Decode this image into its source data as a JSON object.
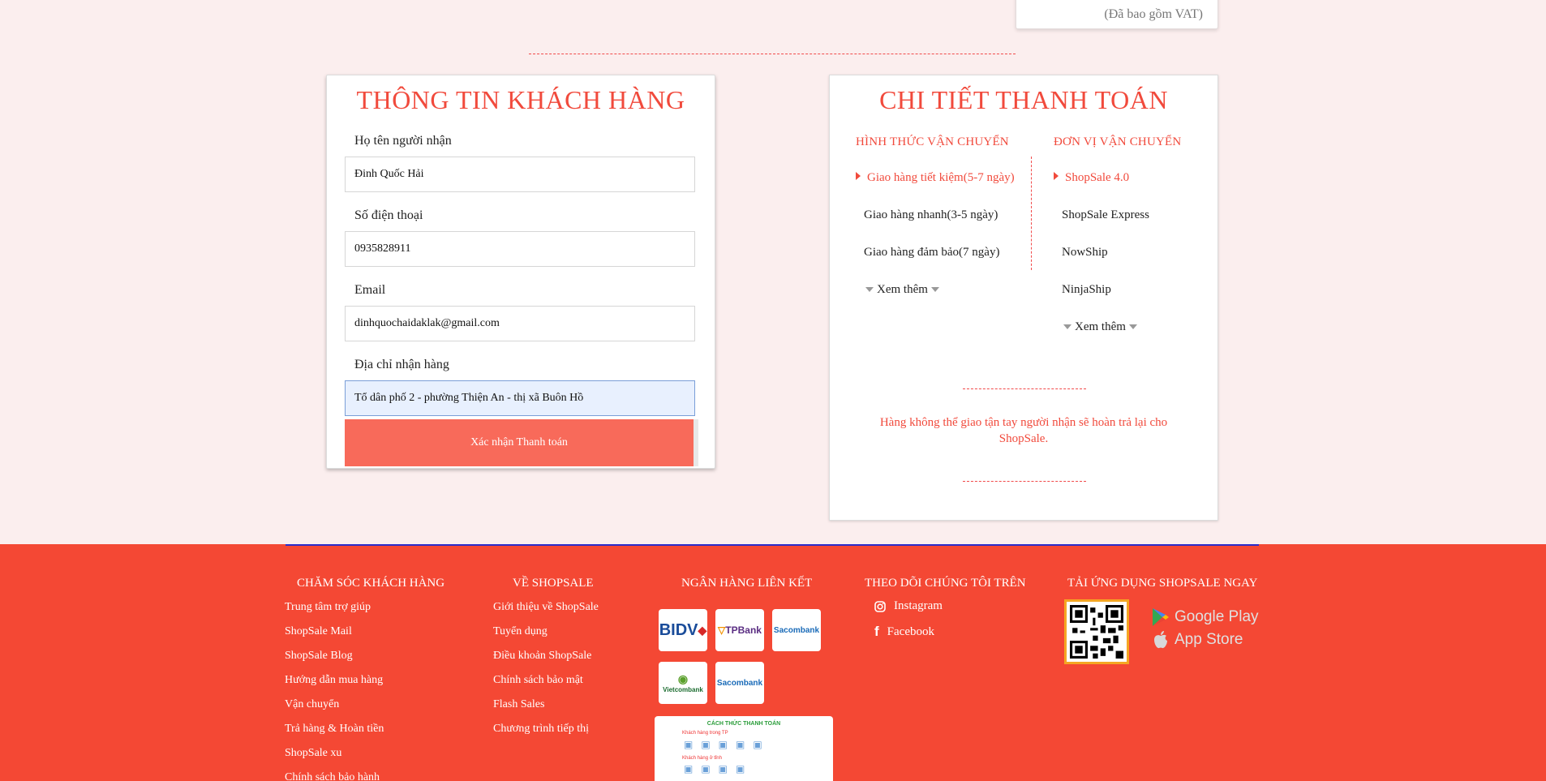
{
  "top_card": {
    "vat_text": "(Đã bao gồm VAT)"
  },
  "customer": {
    "title": "THÔNG TIN KHÁCH HÀNG",
    "fields": [
      {
        "label": "Họ tên người nhận",
        "value": "Đinh Quốc Hải"
      },
      {
        "label": "Số điện thoại",
        "value": "0935828911"
      },
      {
        "label": "Email",
        "value": "dinhquochaidaklak@gmail.com"
      },
      {
        "label": "Địa chỉ nhận hàng",
        "value": "Tổ dân phố 2 - phường Thiện An - thị xã Buôn Hồ"
      }
    ],
    "confirm_label": "Xác nhận Thanh toán"
  },
  "payment": {
    "title": "CHI TIẾT THANH TOÁN",
    "shipping_method_head": "HÌNH THỨC VẬN CHUYỂN",
    "carrier_head": "ĐƠN VỊ VẬN CHUYỂN",
    "methods": [
      "Giao hàng tiết kiệm(5-7 ngày)",
      "Giao hàng nhanh(3-5 ngày)",
      "Giao hàng đảm bảo(7 ngày)"
    ],
    "carriers": [
      "ShopSale 4.0",
      "ShopSale Express",
      "NowShip",
      "NinjaShip"
    ],
    "see_more": "Xem thêm",
    "notice": "Hàng không thể giao tận tay người nhận sẽ hoàn trả lại cho ShopSale."
  },
  "footer": {
    "col_care": "CHĂM SÓC KHÁCH HÀNG",
    "col_about": "VỀ SHOPSALE",
    "col_banks": "NGÂN HÀNG LIÊN KẾT",
    "col_follow": "THEO DÕI CHÚNG TÔI TRÊN",
    "col_app": "TẢI ỨNG DỤNG SHOPSALE NGAY",
    "care_links": [
      "Trung tâm trợ giúp",
      "ShopSale Mail",
      "ShopSale Blog",
      "Hướng dẫn mua hàng",
      "Vận chuyển",
      "Trả hàng & Hoàn tiền",
      "ShopSale xu",
      "Chính sách bảo hành"
    ],
    "about_links": [
      "Giới thiệu về ShopSale",
      "Tuyển dụng",
      "Điều khoản ShopSale",
      "Chính sách bảo mật",
      "Flash Sales",
      "Chương trình tiếp thị"
    ],
    "banks": [
      "BIDV",
      "TPBank",
      "Sacombank",
      "Vietcombank",
      "Sacombank"
    ],
    "payment_guide_title": "CÁCH THỨC THANH TOÁN",
    "payment_guide_line1": "Khách hàng trong TP",
    "payment_guide_line2": "Khách hàng ở tỉnh",
    "social": [
      "Instagram",
      "Facebook"
    ],
    "stores": [
      "Google Play",
      "App Store"
    ]
  }
}
